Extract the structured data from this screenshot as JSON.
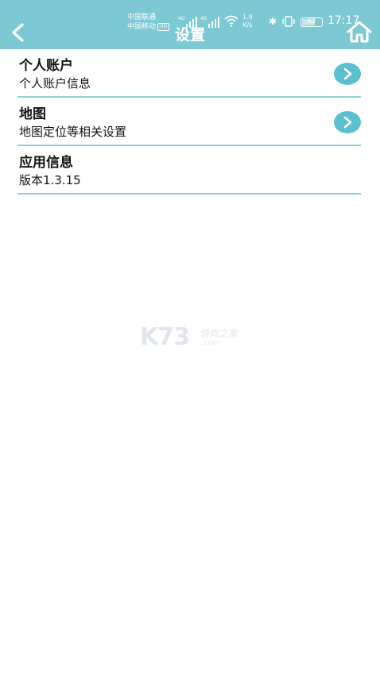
{
  "status_bar": {
    "carrier_1": "中国联通",
    "carrier_2": "中国移动",
    "net_badge": "HD",
    "speed_value": "1.9",
    "speed_unit": "K/s",
    "battery": "62",
    "time": "17:17"
  },
  "header": {
    "title": "设置"
  },
  "settings": [
    {
      "title": "个人账户",
      "subtitle": "个人账户信息"
    },
    {
      "title": "地图",
      "subtitle": "地图定位等相关设置"
    },
    {
      "title": "应用信息",
      "subtitle": "版本1.3.15"
    }
  ],
  "watermark": {
    "logo": "K73",
    "text": "游戏之家",
    "url": ".com"
  },
  "colors": {
    "header": "#7cc8d3",
    "arrow": "#5bbfd0",
    "divider": "#8fd0d9"
  }
}
